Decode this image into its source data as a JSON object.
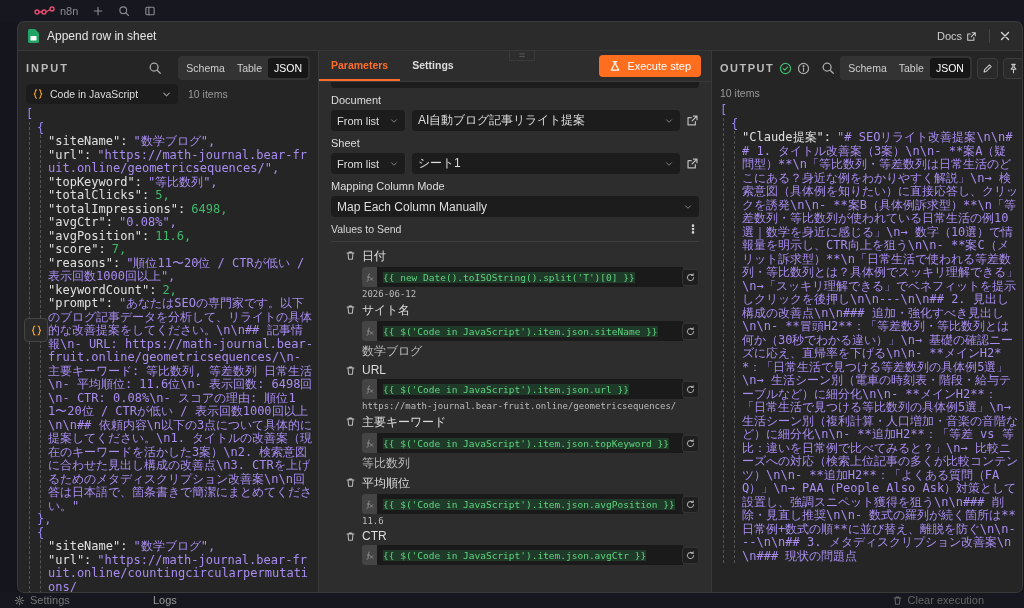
{
  "app": {
    "logo": "n8n",
    "settings": "Settings",
    "logs": "Logs",
    "clear": "Clear execution"
  },
  "modal": {
    "title": "Append row in sheet",
    "docs": "Docs"
  },
  "input": {
    "title": "INPUT",
    "views": [
      {
        "label": "Schema",
        "selected": false
      },
      {
        "label": "Table",
        "selected": false
      },
      {
        "label": "JSON",
        "selected": true
      }
    ],
    "source": "Code in JavaScript",
    "count": "10 items",
    "json": {
      "open": "[",
      "objects": [
        {
          "open": "{",
          "close": "},",
          "fields": [
            {
              "key": "\"siteName\":",
              "value": "\"数学ブログ\",",
              "kind": "string"
            },
            {
              "key": "\"url\":",
              "value": "\"https://math-journal.bear-fruit.online/geometricsequences/\",",
              "kind": "string"
            },
            {
              "key": "\"topKeyword\":",
              "value": "\"等比数列\",",
              "kind": "string"
            },
            {
              "key": "\"totalClicks\":",
              "value": "5,",
              "kind": "number"
            },
            {
              "key": "\"totalImpressions\":",
              "value": "6498,",
              "kind": "number"
            },
            {
              "key": "\"avgCtr\":",
              "value": "\"0.08%\",",
              "kind": "string"
            },
            {
              "key": "\"avgPosition\":",
              "value": "11.6,",
              "kind": "number"
            },
            {
              "key": "\"score\":",
              "value": "7,",
              "kind": "number"
            },
            {
              "key": "\"reasons\":",
              "value": "\"順位11〜20位 / CTRが低い / 表示回数1000回以上\",",
              "kind": "string"
            },
            {
              "key": "\"keywordCount\":",
              "value": "2,",
              "kind": "number"
            },
            {
              "key": "\"prompt\":",
              "value": "\"あなたはSEOの専門家です。以下のブログ記事データを分析して、リライトの具体的な改善提案をしてください。\\n\\n## 記事情報\\n- URL: https://math-journal.bear-fruit.online/geometricsequences/\\n- 主要キーワード: 等比数列, 等差数列 日常生活\\n- 平均順位: 11.6位\\n- 表示回数: 6498回\\n- CTR: 0.08%\\n- スコアの理由: 順位11〜20位 / CTRが低い / 表示回数1000回以上\\n\\n## 依頼内容\\n以下の3点について具体的に提案してください。\\n1. タイトルの改善案（現在のキーワードを活かした3案）\\n2. 検索意図に合わせた見出し構成の改善点\\n3. CTRを上げるためのメタディスクリプション改善案\\n\\n回答は日本語で、箇条書きで簡潔にまとめてください。\"",
              "kind": "string"
            }
          ]
        },
        {
          "open": "{",
          "fields": [
            {
              "key": "\"siteName\":",
              "value": "\"数学ブログ\",",
              "kind": "string"
            },
            {
              "key": "\"url\":",
              "value": "\"https://math-journal.bear-fruit.online/countingcircularpermutations/",
              "kind": "string"
            }
          ]
        }
      ]
    }
  },
  "parameters": {
    "tabs": [
      {
        "label": "Parameters",
        "selected": true
      },
      {
        "label": "Settings",
        "selected": false
      }
    ],
    "execute": "Execute step",
    "fields": [
      {
        "label": "Document",
        "mode": "From list",
        "value": "AI自動ブログ記事リライト提案"
      },
      {
        "label": "Sheet",
        "mode": "From list",
        "value": "シート1"
      }
    ],
    "mapping": {
      "label": "Mapping Column Mode",
      "value": "Map Each Column Manually"
    },
    "values_title": "Values to Send",
    "values": [
      {
        "label": "日付",
        "expression": "{{ new Date().toISOString().split('T')[0] }}",
        "result": "2026-06-12"
      },
      {
        "label": "サイト名",
        "expression": "{{ $('Code in JavaScript').item.json.siteName }}",
        "result": "数学ブログ"
      },
      {
        "label": "URL",
        "expression": "{{ $('Code in JavaScript').item.json.url }}",
        "result": "https://math-journal.bear-fruit.online/geometricsequences/"
      },
      {
        "label": "主要キーワード",
        "expression": "{{ $('Code in JavaScript').item.json.topKeyword }}",
        "result": "等比数列"
      },
      {
        "label": "平均順位",
        "expression": "{{ $('Code in JavaScript').item.json.avgPosition }}",
        "result": "11.6"
      },
      {
        "label": "CTR",
        "expression": "{{ $('Code in JavaScript').item.json.avgCtr }}"
      }
    ]
  },
  "output": {
    "title": "OUTPUT",
    "views": [
      {
        "label": "Schema",
        "selected": false
      },
      {
        "label": "Table",
        "selected": false
      },
      {
        "label": "JSON",
        "selected": true
      }
    ],
    "count": "10 items",
    "json": {
      "open": "[",
      "objects": [
        {
          "open": "{",
          "fields": [
            {
              "key": "\"Claude提案\":",
              "value": "\"# SEOリライト改善提案\\n\\n## 1. タイトル改善案（3案）\\n\\n- **案A（疑問型）**\\n「等比数列・等差数列は日常生活のどこにある？身近な例をわかりやすく解説」\\n→ 検索意図（具体例を知りたい）に直接応答し、クリックを誘発\\n\\n- **案B（具体例訴求型）**\\n「等差数列・等比数列が使われている日常生活の例10選｜数学を身近に感じる」\\n→ 数字（10選）で情報量を明示し、CTR向上を狙う\\n\\n- **案C（メリット訴求型）**\\n「日常生活で使われる等差数列・等比数列とは？具体例でスッキリ理解できる」\\n→「スッキリ理解できる」でベネフィットを提示しクリックを後押し\\n\\n---\\n\\n## 2. 見出し構成の改善点\\n\\n### 追加・強化すべき見出し\\n\\n- **冒頭H2**：「等差数列・等比数列とは何か（30秒でわかる違い）」\\n→ 基礎の確認ニーズに応え、直帰率を下げる\\n\\n- **メインH2**：「日常生活で見つける等差数列の具体例5選」\\n→ 生活シーン別（電車の時刻表・階段・給与テーブルなど）に細分化\\n\\n- **メインH2**：「日常生活で見つける等比数列の具体例5選」\\n→ 生活シーン別（複利計算・人口増加・音楽の音階など）に細分化\\n\\n- **追加H2**：「等差 vs 等比：違いを日常例で比べてみると？」\\n→ 比較ニーズへの対応（検索上位記事の多くが比較コンテンツ）\\n\\n- **追加H2**：「よくある質問（FAQ）」\\n→ PAA（People Also Ask）対策として設置し、強調スニペット獲得を狙う\\n\\n### 削除・見直し推奨\\n\\n- 数式の羅列が続く箇所は**日常例+数式の順**に並び替え、離脱を防ぐ\\n\\n---\\n\\n## 3. メタディスクリプション改善案\\n\\n### 現状の問題点",
              "kind": "string"
            }
          ]
        }
      ]
    }
  }
}
